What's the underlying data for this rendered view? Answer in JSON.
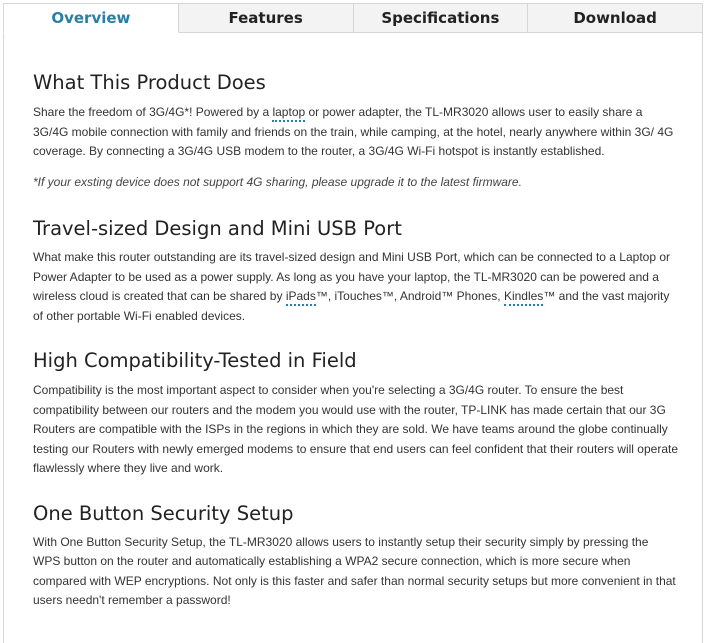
{
  "tabs": [
    "Overview",
    "Features",
    "Specifications",
    "Download"
  ],
  "colors": {
    "accent": "#2a7fa4",
    "tab_bg": "#f3f3f3",
    "border": "#d6d6d6"
  },
  "sections": [
    {
      "title": "What This Product Does",
      "p1_a": "Share the freedom of 3G/4G*! Powered by a ",
      "p1_link": "laptop",
      "p1_b": " or power adapter, the TL-MR3020 allows user to easily share a 3G/4G mobile connection with family and friends on the train, while camping, at the hotel, nearly anywhere within 3G/ 4G coverage.  By connecting a 3G/4G USB modem to the router, a 3G/4G Wi-Fi hotspot is instantly established.",
      "note": "*If your exsting device does not support 4G sharing, please upgrade it to the latest firmware."
    },
    {
      "title": "Travel-sized Design and Mini USB Port",
      "p_a": "What make this router outstanding are its travel-sized design and Mini USB Port, which can be connected to a Laptop or Power Adapter to be used as a power supply. As long as you have your laptop, the TL-MR3020 can be powered and a wireless cloud is created that can be shared by ",
      "p_link1": "iPads",
      "p_b": "™, iTouches™, Android™ Phones, ",
      "p_link2": "Kindles",
      "p_c": "™ and the vast majority of other portable Wi-Fi enabled devices."
    },
    {
      "title": "High Compatibility-Tested in Field",
      "p": "Compatibility is the most important aspect to consider when you're selecting a 3G/4G router. To ensure the best compatibility between our routers and the modem you would use with the router, TP-LINK has made certain that our 3G Routers are compatible with the ISPs in the regions in which they are sold. We have teams around the globe continually testing our Routers with newly emerged modems to ensure that end users can feel confident that their routers will operate flawlessly where they live and work."
    },
    {
      "title": "One Button Security Setup",
      "p": "With One Button Security Setup, the TL-MR3020 allows users to instantly setup their security simply by pressing the WPS button on the router and automatically establishing a WPA2 secure connection, which is more secure when compared with WEP encryptions. Not only is this faster and safer than normal security setups but more convenient in that users needn't remember a password!"
    }
  ]
}
